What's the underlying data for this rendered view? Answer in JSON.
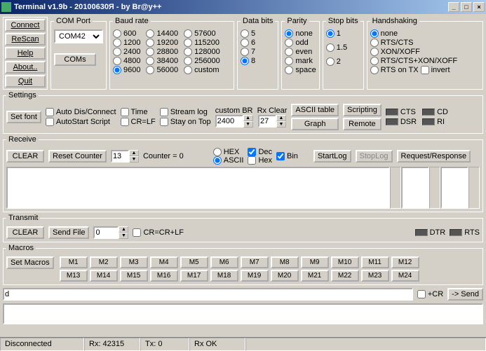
{
  "title": "Terminal v1.9b - 20100630Я - by Br@y++",
  "leftButtons": [
    "Connect",
    "ReScan",
    "Help",
    "About..",
    "Quit"
  ],
  "comPort": {
    "label": "COM Port",
    "value": "COM42",
    "btn": "COMs"
  },
  "baud": {
    "label": "Baud rate",
    "cols": [
      [
        "600",
        "1200",
        "2400",
        "4800",
        "9600"
      ],
      [
        "14400",
        "19200",
        "28800",
        "38400",
        "56000"
      ],
      [
        "57600",
        "115200",
        "128000",
        "256000",
        "custom"
      ]
    ],
    "selected": "9600"
  },
  "databits": {
    "label": "Data bits",
    "opts": [
      "5",
      "6",
      "7",
      "8"
    ],
    "selected": "8"
  },
  "parity": {
    "label": "Parity",
    "opts": [
      "none",
      "odd",
      "even",
      "mark",
      "space"
    ],
    "selected": "none"
  },
  "stopbits": {
    "label": "Stop bits",
    "opts": [
      "1",
      "1.5",
      "2"
    ],
    "selected": "1"
  },
  "handshake": {
    "label": "Handshaking",
    "opts": [
      "none",
      "RTS/CTS",
      "XON/XOFF",
      "RTS/CTS+XON/XOFF",
      "RTS on TX"
    ],
    "selected": "none",
    "invert": "invert"
  },
  "settings": {
    "label": "Settings",
    "setfont": "Set font",
    "cbs": [
      "Auto Dis/Connect",
      "AutoStart Script",
      "Time",
      "CR=LF",
      "Stream log",
      "Stay on Top"
    ],
    "customBR": "custom BR",
    "customBRval": "2400",
    "rxclear": "Rx Clear",
    "rxval": "27",
    "ascii": "ASCII table",
    "graph": "Graph",
    "scripting": "Scripting",
    "remote": "Remote",
    "leds": [
      "CTS",
      "CD",
      "DSR",
      "RI"
    ]
  },
  "receive": {
    "label": "Receive",
    "clear": "CLEAR",
    "reset": "Reset Counter",
    "counterVal": "13",
    "counterTxt": "Counter  =  0",
    "hex": "HEX",
    "ascii": "ASCII",
    "dec": "Dec",
    "hex2": "Hex",
    "bin": "Bin",
    "startlog": "StartLog",
    "stoplog": "StopLog",
    "reqres": "Request/Response"
  },
  "transmit": {
    "label": "Transmit",
    "clear": "CLEAR",
    "sendfile": "Send File",
    "fileval": "0",
    "crcrlf": "CR=CR+LF",
    "dtr": "DTR",
    "rts": "RTS"
  },
  "macros": {
    "label": "Macros",
    "set": "Set Macros",
    "row1": [
      "M1",
      "M2",
      "M3",
      "M4",
      "M5",
      "M6",
      "M7",
      "M8",
      "M9",
      "M10",
      "M11",
      "M12"
    ],
    "row2": [
      "M13",
      "M14",
      "M15",
      "M16",
      "M17",
      "M18",
      "M19",
      "M20",
      "M21",
      "M22",
      "M23",
      "M24"
    ]
  },
  "sendline": {
    "value": "d",
    "cr": "+CR",
    "send": "-> Send"
  },
  "status": {
    "conn": "Disconnected",
    "rx": "Rx: 42315",
    "tx": "Tx: 0",
    "rxok": "Rx OK"
  }
}
